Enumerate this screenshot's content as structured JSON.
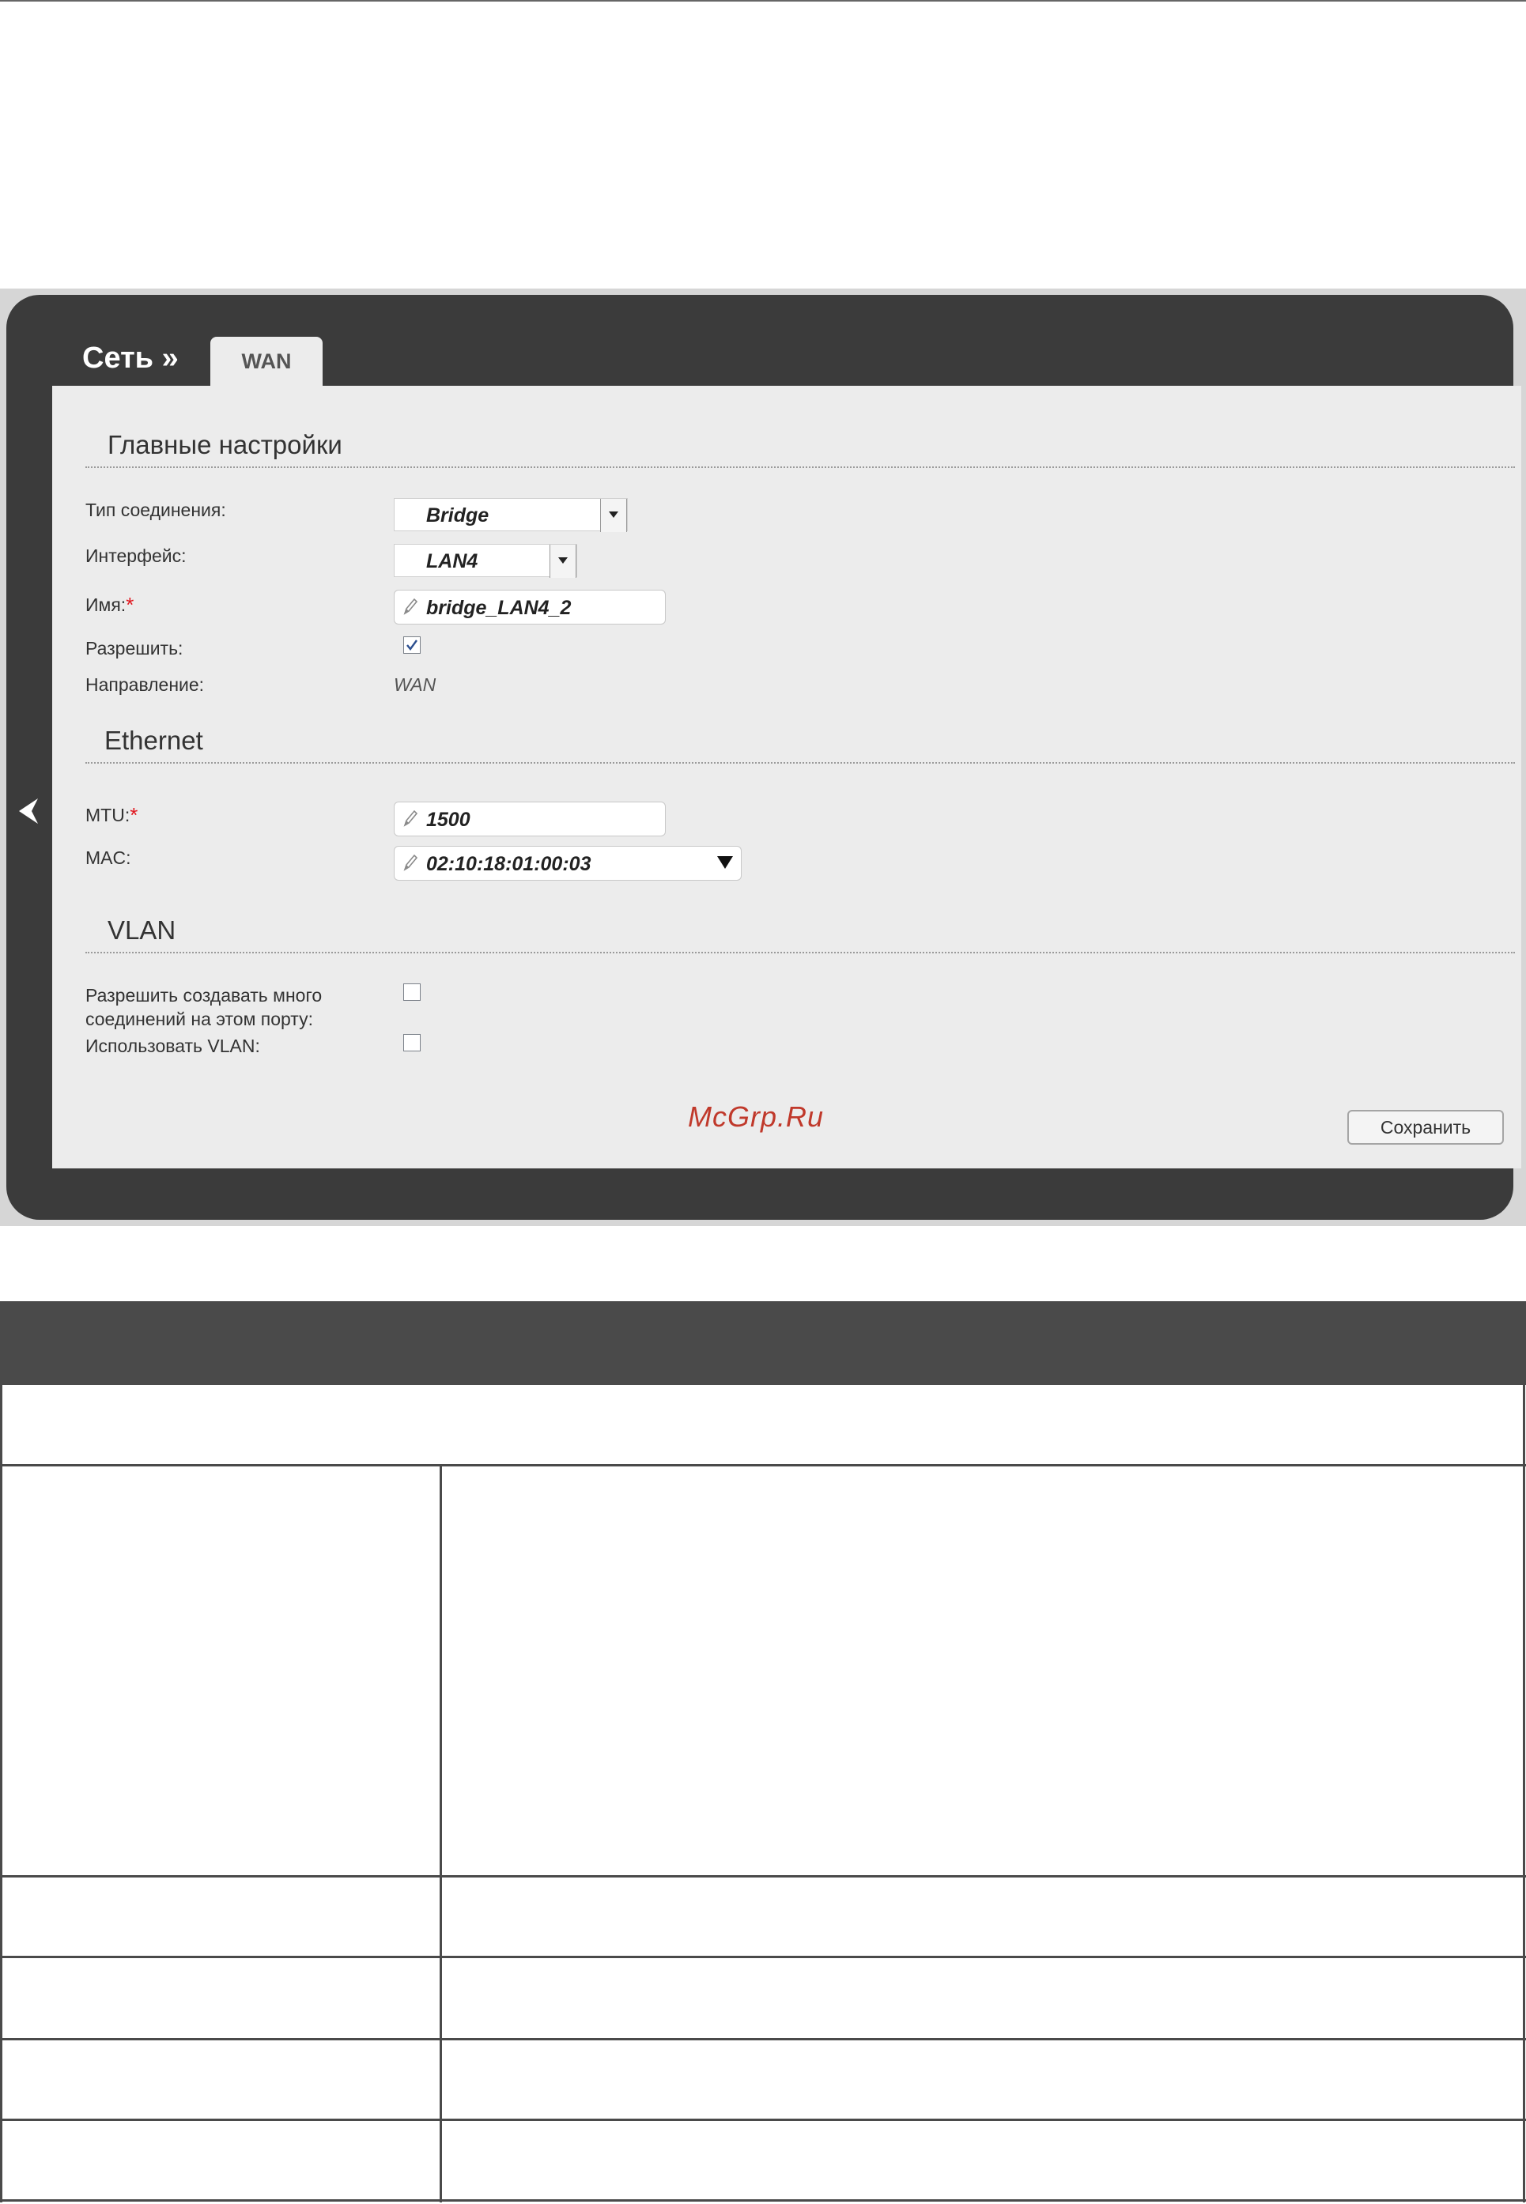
{
  "breadcrumb": "Сеть »",
  "tab": "WAN",
  "sections": {
    "main": "Главные настройки",
    "ethernet": "Ethernet",
    "vlan": "VLAN"
  },
  "fields": {
    "conn_type": {
      "label": "Тип соединения:",
      "value": "Bridge"
    },
    "interface": {
      "label": "Интерфейс:",
      "value": "LAN4"
    },
    "name": {
      "label": "Имя:",
      "required": "*",
      "value": "bridge_LAN4_2"
    },
    "enable": {
      "label": "Разрешить:",
      "checked": true
    },
    "direction": {
      "label": "Направление:",
      "value": "WAN"
    },
    "mtu": {
      "label": "MTU:",
      "required": "*",
      "value": "1500"
    },
    "mac": {
      "label": "MAC:",
      "value": "02:10:18:01:00:03"
    },
    "multi_conn": {
      "label_line1": "Разрешить создавать много",
      "label_line2": "соединений на этом порту:",
      "checked": false
    },
    "use_vlan": {
      "label": "Использовать VLAN:",
      "checked": false
    }
  },
  "save_button": "Сохранить",
  "watermark": "McGrp.Ru",
  "icons": {
    "back": "chevron-left-icon",
    "dropdown": "triangle-down-icon",
    "edit": "pencil-icon",
    "check": "checkmark-icon"
  },
  "colors": {
    "frame_dark": "#3b3b3b",
    "panel": "#ececec",
    "required": "#e0161e",
    "watermark": "#c0392b",
    "table_header": "#4a4a4a"
  }
}
